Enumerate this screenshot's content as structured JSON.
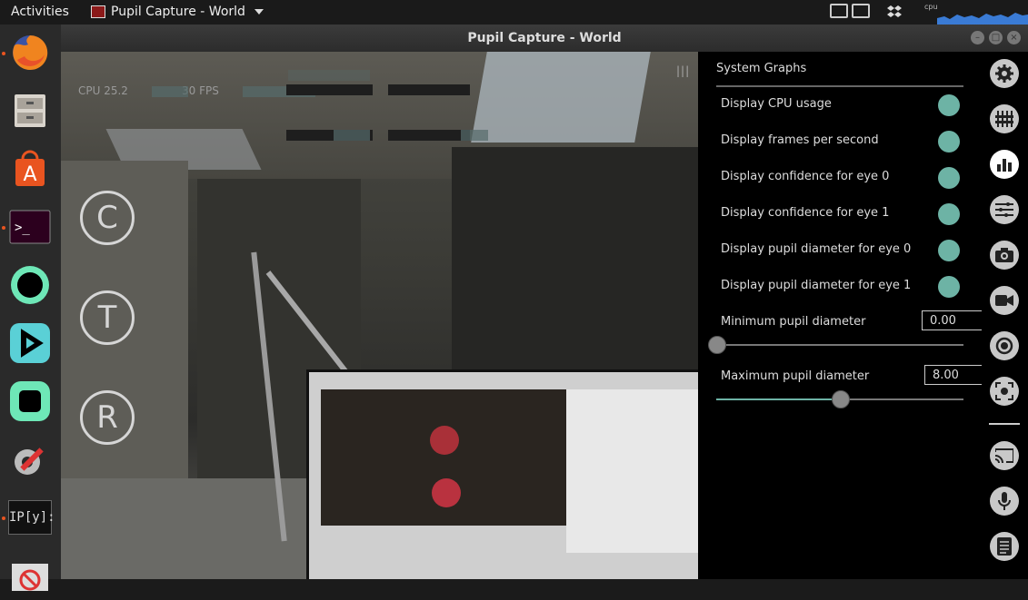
{
  "topbar": {
    "activities": "Activities",
    "app_name": "Pupil Capture - World",
    "cpu_label": "cpu"
  },
  "dock": {
    "items": [
      {
        "name": "firefox"
      },
      {
        "name": "file-cabinet"
      },
      {
        "name": "software-center"
      },
      {
        "name": "terminal"
      },
      {
        "name": "circle-app"
      },
      {
        "name": "play-app"
      },
      {
        "name": "square-app"
      },
      {
        "name": "settings-tools"
      },
      {
        "name": "ipython",
        "label": "IP[y]:"
      },
      {
        "name": "no-entry-app"
      }
    ]
  },
  "window": {
    "title": "Pupil Capture - World"
  },
  "world_view": {
    "cpu_text": "CPU 25.2",
    "fps_text": "30 FPS",
    "quick_buttons": [
      "C",
      "T",
      "R"
    ]
  },
  "panel": {
    "heading": "System Graphs",
    "options": [
      {
        "label": "Display CPU usage",
        "on": true
      },
      {
        "label": "Display frames per second",
        "on": true
      },
      {
        "label": "Display confidence for eye 0",
        "on": true
      },
      {
        "label": "Display confidence for eye 1",
        "on": true
      },
      {
        "label": "Display pupil diameter for eye 0",
        "on": true
      },
      {
        "label": "Display pupil diameter for eye 1",
        "on": true
      }
    ],
    "min_pupil": {
      "label": "Minimum pupil diameter",
      "value": "0.00",
      "slider_fraction": 0.0
    },
    "max_pupil": {
      "label": "Maximum pupil diameter",
      "value": "8.00",
      "slider_fraction": 0.5
    }
  },
  "iconbar": {
    "icons": [
      "gear-icon",
      "sliders-icon",
      "bar-chart-icon",
      "list-settings-icon",
      "camera-icon",
      "video-camera-icon",
      "record-icon",
      "focus-capture-icon",
      "cast-icon",
      "microphone-icon",
      "notes-icon"
    ]
  },
  "colors": {
    "accent": "#6db3a5"
  }
}
